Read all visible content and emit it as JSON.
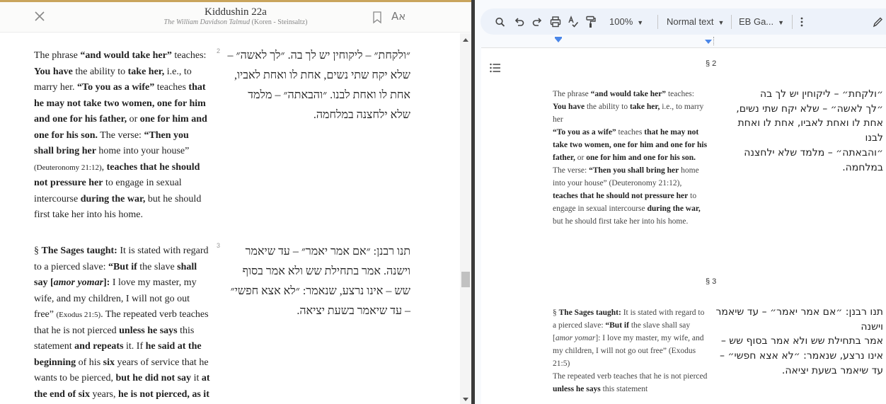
{
  "reader": {
    "title": "Kiddushin 22a",
    "subtitle_italic": "The William Davidson Talmud",
    "subtitle_rest": " (Koren - Steinsaltz)",
    "lang_toggle": "Aא",
    "segments": [
      {
        "number": "2",
        "en_html": "The phrase <b>“and would take her”</b> teaches: <b>You have</b> the ability to <b>take her,</b> i.e., to marry her. <b>“To you as a wife”</b> teaches <b>that he may not take two women, one for him and one for his father,</b> or <b>one for him and one for his son.</b> The verse: <b>“Then you shall bring her</b> home into your house” <span class=\"ref\">(Deuteronomy 21:12)</span>, <b>teaches that he should not pressure her</b> to engage in sexual intercourse <b>during the war,</b> but he should first take her into his home.",
        "he": "״ולקחת״ – ליקוחין יש לך בה. ״לך לאשה״ – שלא יקח שתי נשים, אחת לו ואחת לאביו, אחת לו ואחת לבנו. ״והבאתה״ – מלמד שלא ילחצנה במלחמה."
      },
      {
        "number": "3",
        "en_html": "§ <b>The Sages taught:</b> It is stated with regard to a pierced slave: <b>“But if</b> the slave <b>shall say [<i>amor yomar</i>]:</b> I love my master, my wife, and my children, I will not go out free” <span class=\"ref\">(Exodus 21:5)</span>. The repeated verb teaches that he is not pierced <b>unless he says</b> this statement <b>and repeats</b> it. If <b>he said at the beginning</b> of his <b>six</b> years of service that he wants to be pierced, <b>but he did not say</b> it <b>at the end of six</b> years, <b>he is not pierced, as it</b>",
        "he": "תנו רבנן: ״אם אמר יאמר״ – עד שיאמר וישנה. אמר בתחילת שש ולא אמר בסוף שש – אינו נרצע, שנאמר: ״לא אצא חפשי״ – עד שיאמר בשעת יציאה."
      }
    ]
  },
  "docs": {
    "zoom": "100%",
    "style": "Normal text",
    "font": "EB Ga...",
    "sections": [
      {
        "label": "§ 2",
        "en_html": "The phrase <b>“and would take her”</b> teaches: <b>You have</b> the ability to <b>take her,</b> i.e., to marry her<br><b>“To you as a wife”</b> teaches <b>that he may not take two women, one for him and one for his father,</b> or <b>one for him and one for his son.</b> The verse: <b>“Then you shall bring her</b> home into your house” (Deuteronomy 21:12), <b>teaches that he should not pressure her</b> to engage in sexual intercourse <b>during the war,</b> but he should first take her into his home.",
        "he_lines": [
          "״ולקחת״ – ליקוחין יש לך בה",
          "״לך לאשה״ – שלא יקח שתי נשים,",
          "אחת לו ואחת לאביו, אחת לו ואחת",
          "לבנו",
          "״והבאתה״ – מלמד שלא ילחצנה",
          "במלחמה."
        ]
      },
      {
        "label": "§ 3",
        "en_html": "§ <b>The Sages taught:</b> It is stated with regard to a pierced slave: <b>“But if</b> the slave shall say [<i>amor yomar</i>]: I love my master, my wife, and my children, I will not go out free” (Exodus 21:5)<br>The repeated verb teaches that he is not pierced <b>unless he says</b> this statement",
        "he_lines": [
          "תנו רבנן: ״אם אמר יאמר״ – עד שיאמר",
          "וישנה",
          "אמר בתחילת שש ולא אמר בסוף שש –",
          "אינו נרצע, שנאמר: ״לא אצא חפשי״ –",
          "עד שיאמר בשעת יציאה."
        ]
      }
    ]
  }
}
